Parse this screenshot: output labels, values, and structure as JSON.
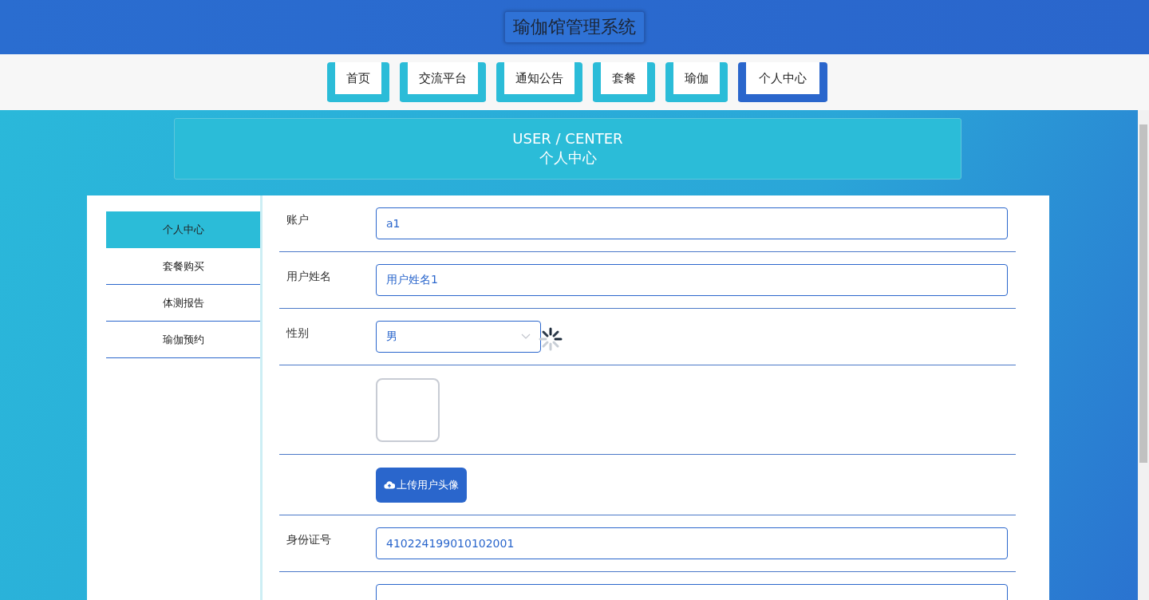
{
  "header": {
    "title": "瑜伽馆管理系统"
  },
  "nav": [
    {
      "label": "首页",
      "selected": false
    },
    {
      "label": "交流平台",
      "selected": false
    },
    {
      "label": "通知公告",
      "selected": false
    },
    {
      "label": "套餐",
      "selected": false
    },
    {
      "label": "瑜伽",
      "selected": false
    },
    {
      "label": "个人中心",
      "selected": true
    }
  ],
  "banner": {
    "title": "USER / CENTER",
    "subtitle": "个人中心"
  },
  "sidebar": {
    "items": [
      {
        "label": "个人中心",
        "selected": true
      },
      {
        "label": "套餐购买",
        "selected": false
      },
      {
        "label": "体测报告",
        "selected": false
      },
      {
        "label": "瑜伽预约",
        "selected": false
      }
    ]
  },
  "form": {
    "loading": true,
    "rows": [
      {
        "kind": "text",
        "label": "账户",
        "value": "a1"
      },
      {
        "kind": "text",
        "label": "用户姓名",
        "value": "用户姓名1"
      },
      {
        "kind": "select",
        "label": "性别",
        "value": "男"
      },
      {
        "kind": "image"
      },
      {
        "kind": "upload",
        "button": "上传用户头像"
      },
      {
        "kind": "text",
        "label": "身份证号",
        "value": "410224199010102001"
      },
      {
        "kind": "text"
      }
    ]
  }
}
